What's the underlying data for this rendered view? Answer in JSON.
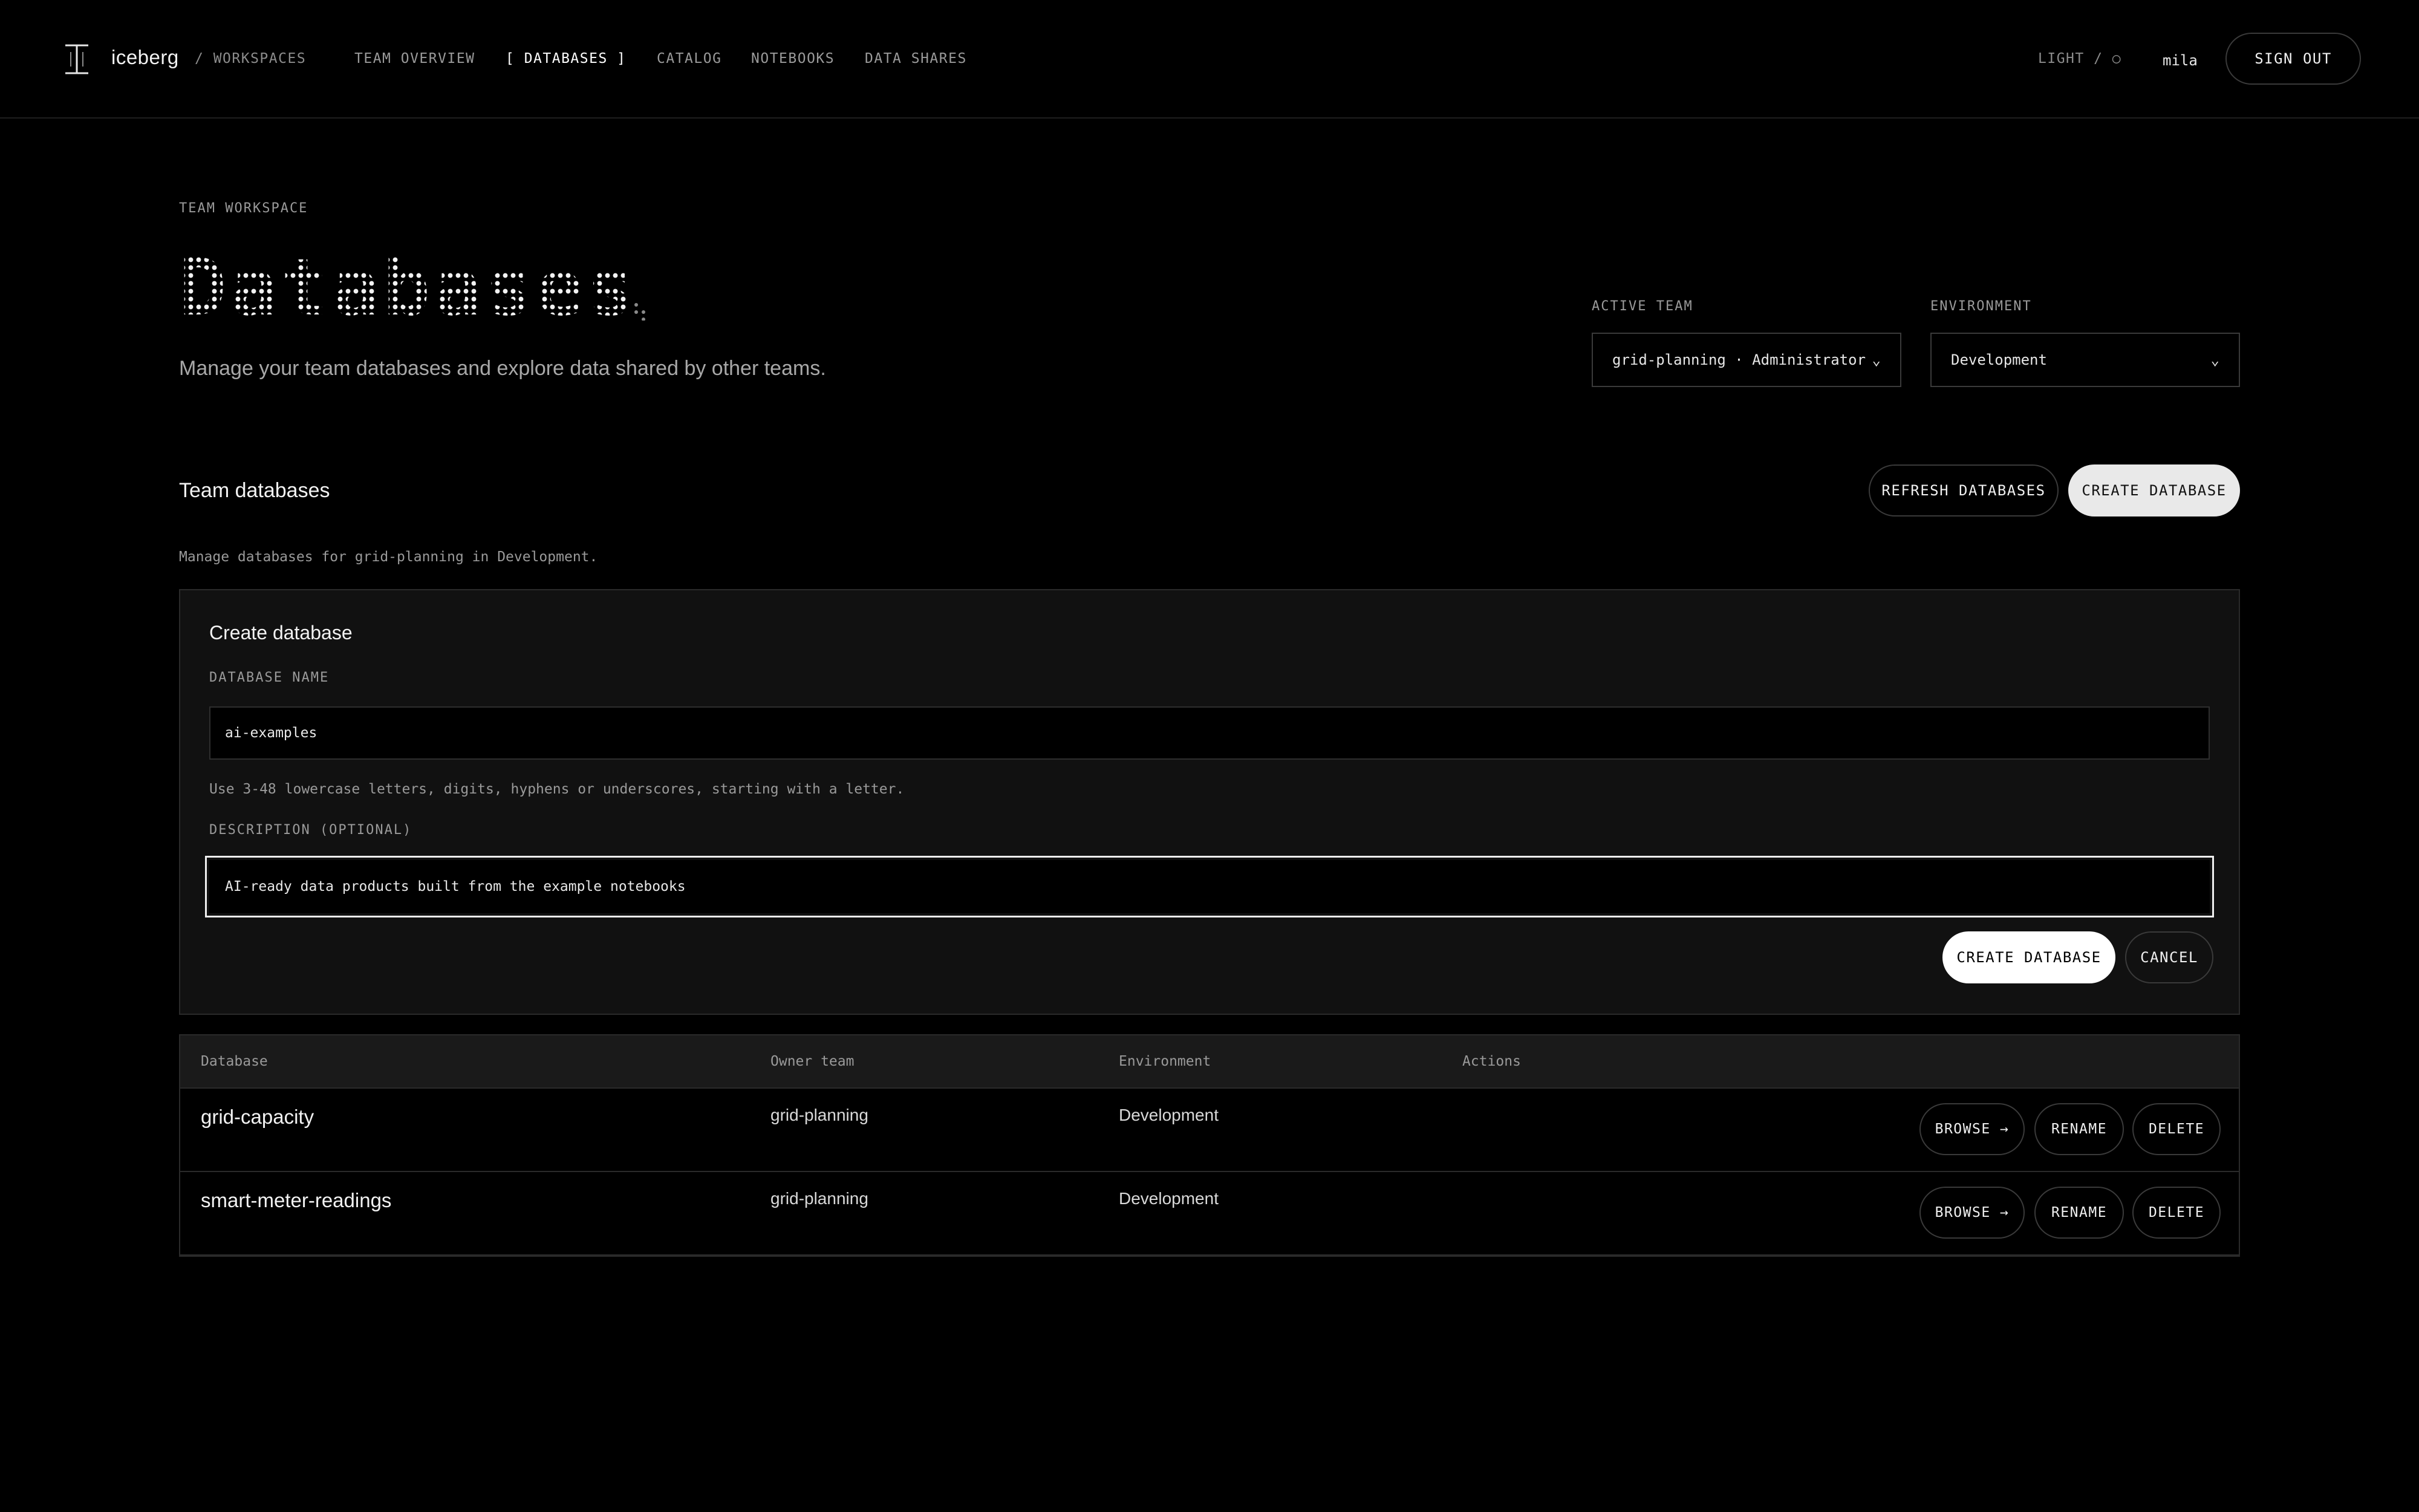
{
  "header": {
    "brand": "iceberg",
    "crumb": "/ WORKSPACES",
    "nav": [
      "TEAM OVERVIEW",
      "[ DATABASES ]",
      "CATALOG",
      "NOTEBOOKS",
      "DATA SHARES"
    ],
    "theme_toggle": "LIGHT / ○",
    "user": "mila",
    "sign_out": "SIGN OUT"
  },
  "page": {
    "eyebrow": "TEAM WORKSPACE",
    "title": "Databases",
    "subtitle": "Manage your team databases and explore data shared by other teams."
  },
  "filters": {
    "active_team_label": "ACTIVE TEAM",
    "active_team_value": "grid-planning · Administrator",
    "environment_label": "ENVIRONMENT",
    "environment_value": "Development"
  },
  "section": {
    "title": "Team databases",
    "refresh_label": "REFRESH DATABASES",
    "create_label": "CREATE DATABASE",
    "description": "Manage databases for grid-planning in Development."
  },
  "create_form": {
    "title": "Create database",
    "name_label": "DATABASE NAME",
    "name_value": "ai-examples",
    "name_hint": "Use 3-48 lowercase letters, digits, hyphens or underscores, starting with a letter.",
    "description_label": "DESCRIPTION (OPTIONAL)",
    "description_value": "AI-ready data products built from the example notebooks",
    "submit_label": "CREATE DATABASE",
    "cancel_label": "CANCEL"
  },
  "table": {
    "columns": [
      "Database",
      "Owner team",
      "Environment",
      "Actions"
    ],
    "rows": [
      {
        "name": "grid-capacity",
        "owner": "grid-planning",
        "environment": "Development"
      },
      {
        "name": "smart-meter-readings",
        "owner": "grid-planning",
        "environment": "Development"
      }
    ],
    "actions": {
      "browse": "BROWSE →",
      "rename": "RENAME",
      "delete": "DELETE"
    }
  },
  "colors": {
    "background": "#000000",
    "panel": "#111111",
    "border": "#2a2a2a",
    "text_primary": "#f2f2f2",
    "text_muted": "#9a9a9a"
  }
}
